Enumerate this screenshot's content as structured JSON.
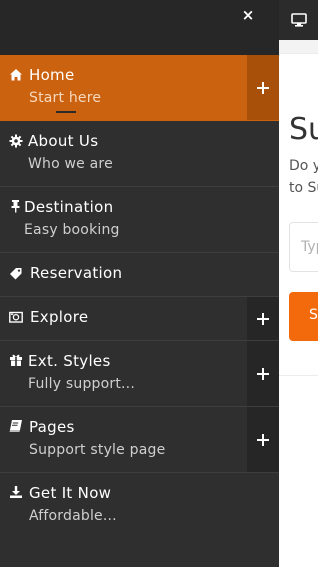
{
  "menu": {
    "close_label": "×",
    "items": [
      {
        "title": "Home",
        "subtitle": "Start here",
        "icon": "home-icon",
        "active": true,
        "expandable": true
      },
      {
        "title": "About Us",
        "subtitle": "Who we are",
        "icon": "gear-icon",
        "active": false,
        "expandable": false
      },
      {
        "title": "Destination",
        "subtitle": "Easy booking",
        "icon": "pin-icon",
        "active": false,
        "expandable": false
      },
      {
        "title": "Reservation",
        "subtitle": "",
        "icon": "tag-icon",
        "active": false,
        "expandable": false
      },
      {
        "title": "Explore",
        "subtitle": "",
        "icon": "camera-icon",
        "active": false,
        "expandable": true
      },
      {
        "title": "Ext. Styles",
        "subtitle": "Fully support...",
        "icon": "gift-icon",
        "active": false,
        "expandable": true
      },
      {
        "title": "Pages",
        "subtitle": "Support style page",
        "icon": "book-icon",
        "active": false,
        "expandable": true
      },
      {
        "title": "Get It Now",
        "subtitle": "Affordable...",
        "icon": "download-icon",
        "active": false,
        "expandable": false
      }
    ]
  },
  "page": {
    "heading_fragment": "Su",
    "text_line1": "Do y",
    "text_line2": "to Su",
    "input_placeholder": "Typ",
    "button_label": "Su"
  },
  "colors": {
    "menu_bg": "#2f2f2f",
    "active_bg": "#cb620f",
    "button": "#f26a0c"
  }
}
